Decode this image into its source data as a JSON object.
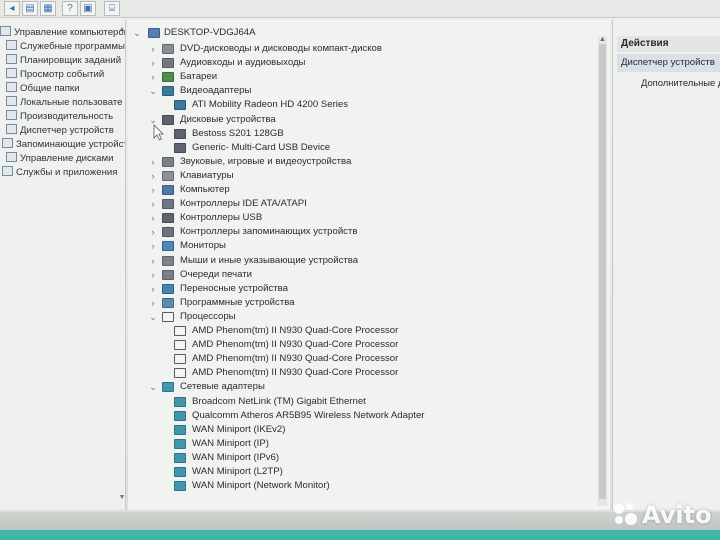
{
  "toolbar": {
    "buttons": [
      "back-icon",
      "show-hide-tree-icon",
      "properties-icon",
      "help-icon",
      "monitor-icon"
    ]
  },
  "left_nav": {
    "items": [
      {
        "label": "Управление компьютером (л",
        "icon": "computer-management-icon"
      },
      {
        "label": "Служебные программы",
        "icon": "tools-icon"
      },
      {
        "label": "Планировщик заданий",
        "icon": "task-scheduler-icon"
      },
      {
        "label": "Просмотр событий",
        "icon": "event-viewer-icon"
      },
      {
        "label": "Общие папки",
        "icon": "shared-folders-icon"
      },
      {
        "label": "Локальные пользовате",
        "icon": "local-users-icon"
      },
      {
        "label": "Производительность",
        "icon": "performance-icon"
      },
      {
        "label": "Диспетчер устройств",
        "icon": "device-manager-icon"
      },
      {
        "label": "Запоминающие устройст",
        "icon": "storage-icon"
      },
      {
        "label": "Управление дисками",
        "icon": "disk-management-icon"
      },
      {
        "label": "Службы и приложения",
        "icon": "services-icon"
      }
    ]
  },
  "device_tree": {
    "root": "DESKTOP-VDGJ64A",
    "rows": [
      {
        "label": "DVD-дисководы и дисководы компакт-дисков",
        "level": 1,
        "expanded": false,
        "icon": "dvd-drive-icon"
      },
      {
        "label": "Аудиовходы и аудиовыходы",
        "level": 1,
        "expanded": false,
        "icon": "audio-io-icon"
      },
      {
        "label": "Батареи",
        "level": 1,
        "expanded": false,
        "icon": "battery-icon"
      },
      {
        "label": "Видеоадаптеры",
        "level": 1,
        "expanded": true,
        "icon": "display-adapter-icon"
      },
      {
        "label": "ATI Mobility Radeon HD 4200 Series",
        "level": 2,
        "icon": "display-adapter-icon"
      },
      {
        "label": "Дисковые устройства",
        "level": 1,
        "expanded": true,
        "icon": "disk-drive-icon"
      },
      {
        "label": "Bestoss S201 128GB",
        "level": 2,
        "icon": "disk-drive-icon"
      },
      {
        "label": "Generic- Multi-Card USB Device",
        "level": 2,
        "icon": "disk-drive-icon"
      },
      {
        "label": "Звуковые, игровые и видеоустройства",
        "level": 1,
        "expanded": false,
        "icon": "sound-icon"
      },
      {
        "label": "Клавиатуры",
        "level": 1,
        "expanded": false,
        "icon": "keyboard-icon"
      },
      {
        "label": "Компьютер",
        "level": 1,
        "expanded": false,
        "icon": "computer-icon"
      },
      {
        "label": "Контроллеры IDE ATA/ATAPI",
        "level": 1,
        "expanded": false,
        "icon": "ide-controller-icon"
      },
      {
        "label": "Контроллеры USB",
        "level": 1,
        "expanded": false,
        "icon": "usb-icon"
      },
      {
        "label": "Контроллеры запоминающих устройств",
        "level": 1,
        "expanded": false,
        "icon": "storage-controller-icon"
      },
      {
        "label": "Мониторы",
        "level": 1,
        "expanded": false,
        "icon": "monitor-icon"
      },
      {
        "label": "Мыши и иные указывающие устройства",
        "level": 1,
        "expanded": false,
        "icon": "mouse-icon"
      },
      {
        "label": "Очереди печати",
        "level": 1,
        "expanded": false,
        "icon": "printer-icon"
      },
      {
        "label": "Переносные устройства",
        "level": 1,
        "expanded": false,
        "icon": "portable-device-icon"
      },
      {
        "label": "Программные устройства",
        "level": 1,
        "expanded": false,
        "icon": "software-device-icon"
      },
      {
        "label": "Процессоры",
        "level": 1,
        "expanded": true,
        "icon": "processor-icon"
      },
      {
        "label": "AMD Phenom(tm) II N930 Quad-Core Processor",
        "level": 2,
        "icon": "processor-icon"
      },
      {
        "label": "AMD Phenom(tm) II N930 Quad-Core Processor",
        "level": 2,
        "icon": "processor-icon"
      },
      {
        "label": "AMD Phenom(tm) II N930 Quad-Core Processor",
        "level": 2,
        "icon": "processor-icon"
      },
      {
        "label": "AMD Phenom(tm) II N930 Quad-Core Processor",
        "level": 2,
        "icon": "processor-icon"
      },
      {
        "label": "Сетевые адаптеры",
        "level": 1,
        "expanded": true,
        "icon": "network-adapter-icon"
      },
      {
        "label": "Broadcom NetLink (TM) Gigabit Ethernet",
        "level": 2,
        "icon": "network-adapter-icon"
      },
      {
        "label": "Qualcomm Atheros AR5B95 Wireless Network Adapter",
        "level": 2,
        "icon": "network-adapter-icon"
      },
      {
        "label": "WAN Miniport (IKEv2)",
        "level": 2,
        "icon": "network-adapter-icon"
      },
      {
        "label": "WAN Miniport (IP)",
        "level": 2,
        "icon": "network-adapter-icon"
      },
      {
        "label": "WAN Miniport (IPv6)",
        "level": 2,
        "icon": "network-adapter-icon"
      },
      {
        "label": "WAN Miniport (L2TP)",
        "level": 2,
        "icon": "network-adapter-icon"
      },
      {
        "label": "WAN Miniport (Network Monitor)",
        "level": 2,
        "icon": "network-adapter-icon"
      }
    ]
  },
  "actions": {
    "header": "Действия",
    "section": "Диспетчер устройств",
    "link": "Дополнительные д"
  },
  "watermark": {
    "text": "Avito",
    "icon": "avito-logo-icon"
  },
  "colors": {
    "tree_bg": "#f0f3f0",
    "actions_section_bg": "#d8e0e8",
    "bottom_teal": "#3fb6a6"
  }
}
